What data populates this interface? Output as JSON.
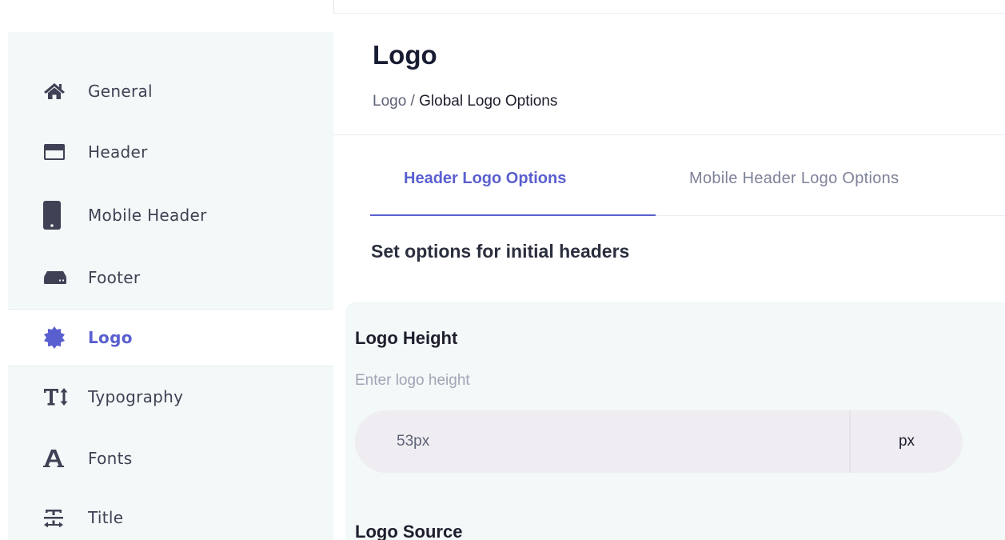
{
  "sidebar": {
    "items": [
      {
        "label": "General",
        "icon": "home-icon"
      },
      {
        "label": "Header",
        "icon": "header-icon"
      },
      {
        "label": "Mobile Header",
        "icon": "mobile-icon"
      },
      {
        "label": "Footer",
        "icon": "footer-icon"
      },
      {
        "label": "Logo",
        "icon": "badge-icon",
        "active": true
      },
      {
        "label": "Typography",
        "icon": "text-height-icon"
      },
      {
        "label": "Fonts",
        "icon": "font-icon"
      },
      {
        "label": "Title",
        "icon": "text-strike-icon"
      }
    ]
  },
  "page": {
    "title": "Logo",
    "breadcrumb": {
      "parent": "Logo",
      "separator": " / ",
      "current": "Global Logo Options"
    }
  },
  "tabs": [
    {
      "label": "Header Logo Options",
      "active": true
    },
    {
      "label": "Mobile Header Logo Options",
      "active": false
    }
  ],
  "section": {
    "heading": "Set options for initial headers"
  },
  "logo_height": {
    "label": "Logo Height",
    "hint": "Enter logo height",
    "value": "53px",
    "unit": "px"
  },
  "logo_source": {
    "label": "Logo Source"
  },
  "colors": {
    "accent": "#5a5fcf",
    "sidebar_bg": "#f3f8f8",
    "icon": "#3f4254"
  }
}
